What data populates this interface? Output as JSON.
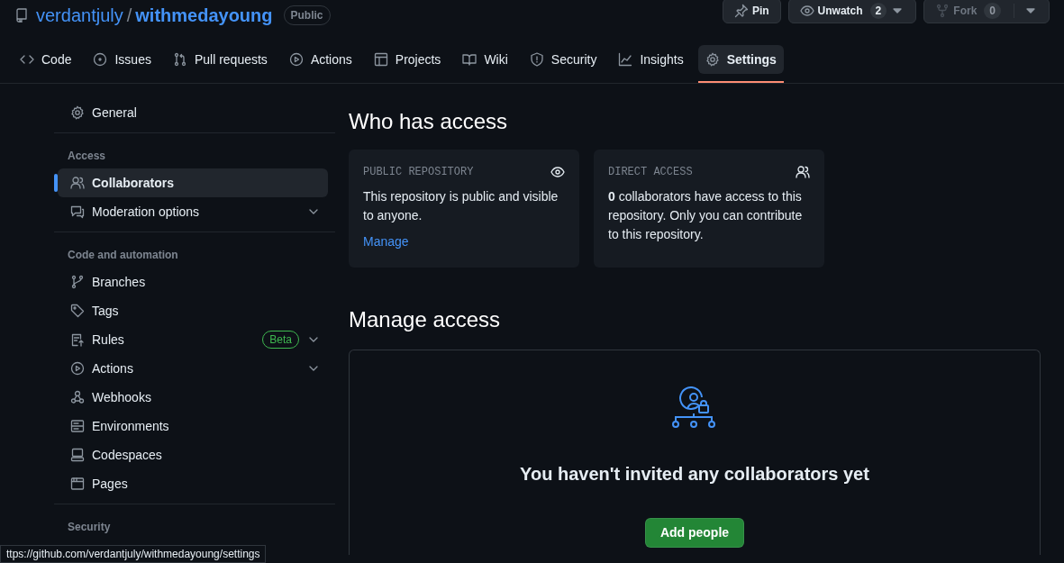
{
  "repo": {
    "owner": "verdantjuly",
    "separator": "/",
    "name": "withmedayoung",
    "visibility": "Public"
  },
  "header_buttons": [
    {
      "label": "Pin",
      "caret": false,
      "disabled": false
    },
    {
      "label": "Unwatch",
      "count": "2",
      "caret": true,
      "disabled": false
    },
    {
      "label": "Fork",
      "count": "0",
      "caret": true,
      "disabled": true
    }
  ],
  "tabs": [
    {
      "label": "Code",
      "selected": false
    },
    {
      "label": "Issues",
      "selected": false
    },
    {
      "label": "Pull requests",
      "selected": false
    },
    {
      "label": "Actions",
      "selected": false
    },
    {
      "label": "Projects",
      "selected": false
    },
    {
      "label": "Wiki",
      "selected": false
    },
    {
      "label": "Security",
      "selected": false
    },
    {
      "label": "Insights",
      "selected": false
    },
    {
      "label": "Settings",
      "selected": true
    }
  ],
  "sidebar": {
    "sections": [
      {
        "items": [
          {
            "label": "General",
            "selected": false,
            "expandable": false
          }
        ]
      },
      {
        "heading": "Access",
        "items": [
          {
            "label": "Collaborators",
            "selected": true,
            "expandable": false
          },
          {
            "label": "Moderation options",
            "selected": false,
            "expandable": true
          }
        ]
      },
      {
        "heading": "Code and automation",
        "items": [
          {
            "label": "Branches",
            "selected": false,
            "expandable": false
          },
          {
            "label": "Tags",
            "selected": false,
            "expandable": false
          },
          {
            "label": "Rules",
            "selected": false,
            "expandable": true,
            "badge": "Beta"
          },
          {
            "label": "Actions",
            "selected": false,
            "expandable": true
          },
          {
            "label": "Webhooks",
            "selected": false,
            "expandable": false
          },
          {
            "label": "Environments",
            "selected": false,
            "expandable": false
          },
          {
            "label": "Codespaces",
            "selected": false,
            "expandable": false
          },
          {
            "label": "Pages",
            "selected": false,
            "expandable": false
          }
        ]
      },
      {
        "heading": "Security"
      }
    ]
  },
  "who_has_access": {
    "title": "Who has access",
    "cards": [
      {
        "heading": "PUBLIC REPOSITORY",
        "text": "This repository is public and visible to anyone.",
        "link": "Manage"
      },
      {
        "heading": "DIRECT ACCESS",
        "text": "**0** collaborators have access to this repository. Only you can contribute to this repository."
      }
    ]
  },
  "manage_access": {
    "title": "Manage access",
    "empty_message": "You haven't invited any collaborators yet",
    "button": "Add people"
  },
  "status_url": "ttps://github.com/verdantjuly/withmedayoung/settings"
}
